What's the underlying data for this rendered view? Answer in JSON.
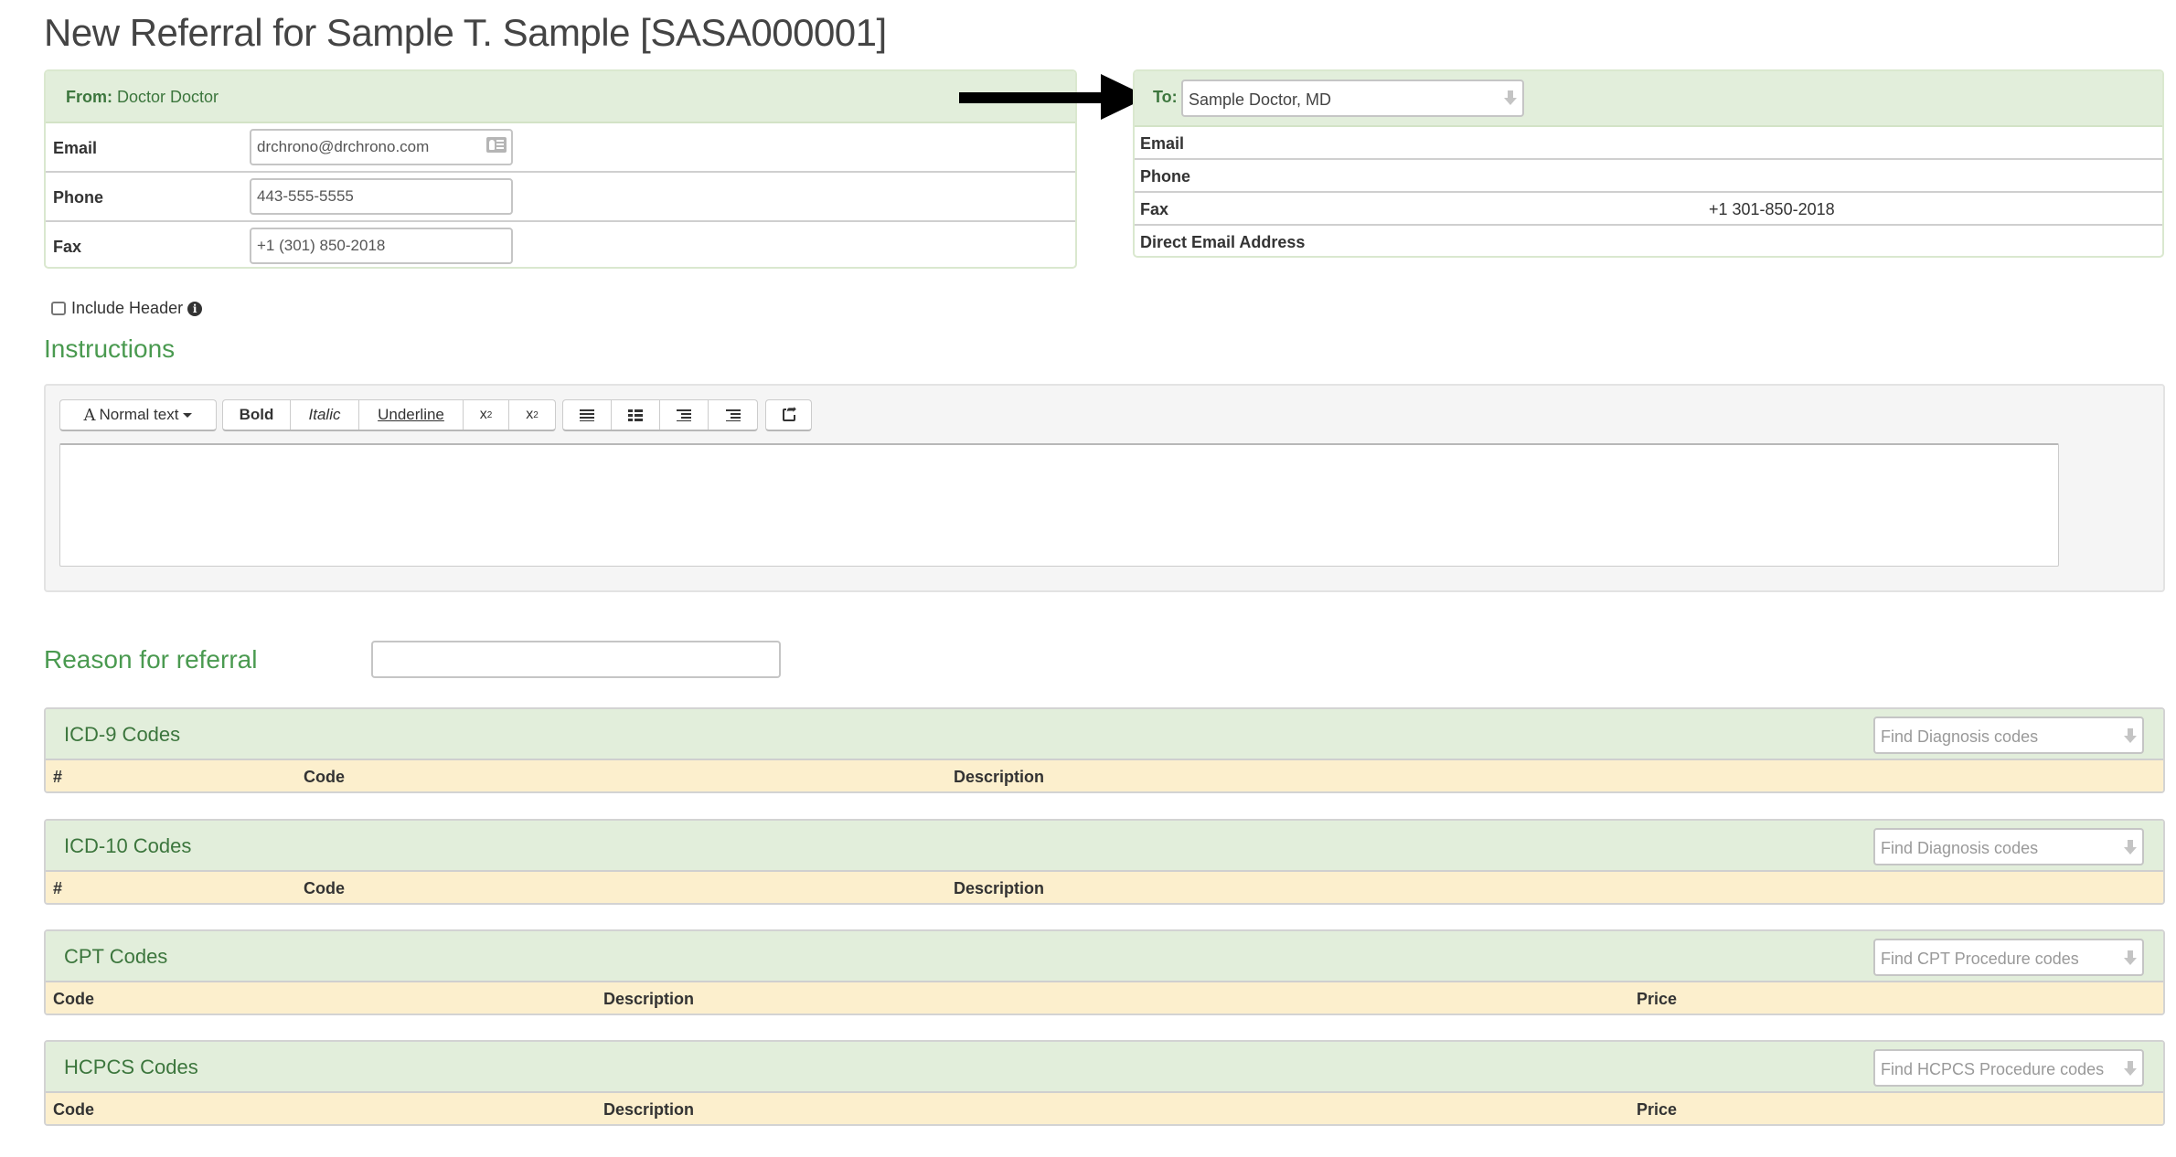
{
  "page": {
    "title": "New Referral for Sample T. Sample [SASA000001]"
  },
  "from": {
    "label": "From:",
    "name": "Doctor Doctor",
    "rows": [
      {
        "label": "Email",
        "value": "drchrono@drchrono.com"
      },
      {
        "label": "Phone",
        "value": "443-555-5555"
      },
      {
        "label": "Fax",
        "value": "+1 (301) 850-2018"
      }
    ]
  },
  "to": {
    "label": "To:",
    "selected": "Sample Doctor, MD",
    "rows": [
      {
        "label": "Email",
        "value": ""
      },
      {
        "label": "Phone",
        "value": ""
      },
      {
        "label": "Fax",
        "value": "+1 301-850-2018"
      },
      {
        "label": "Direct Email Address",
        "value": ""
      }
    ]
  },
  "include_header": {
    "label": "Include Header",
    "checked": false
  },
  "instructions": {
    "heading": "Instructions",
    "toolbar": {
      "text_style": "Normal text",
      "bold": "Bold",
      "italic": "Italic",
      "underline": "Underline",
      "subscript": "x",
      "subscript_mark": "2",
      "superscript": "x",
      "superscript_mark": "2"
    },
    "content": ""
  },
  "reason": {
    "heading": "Reason for referral",
    "value": ""
  },
  "code_sections": [
    {
      "title": "ICD-9 Codes",
      "search_placeholder": "Find Diagnosis codes",
      "columns": [
        "#",
        "Code",
        "Description"
      ]
    },
    {
      "title": "ICD-10 Codes",
      "search_placeholder": "Find Diagnosis codes",
      "columns": [
        "#",
        "Code",
        "Description"
      ]
    },
    {
      "title": "CPT Codes",
      "search_placeholder": "Find CPT Procedure codes",
      "columns": [
        "Code",
        "Description",
        "Price"
      ]
    },
    {
      "title": "HCPCS Codes",
      "search_placeholder": "Find HCPCS Procedure codes",
      "columns": [
        "Code",
        "Description",
        "Price"
      ]
    }
  ],
  "colors": {
    "panel_header_bg": "#e2eedb",
    "heading_green": "#4a9a50",
    "table_header_bg": "#fcefcd"
  }
}
